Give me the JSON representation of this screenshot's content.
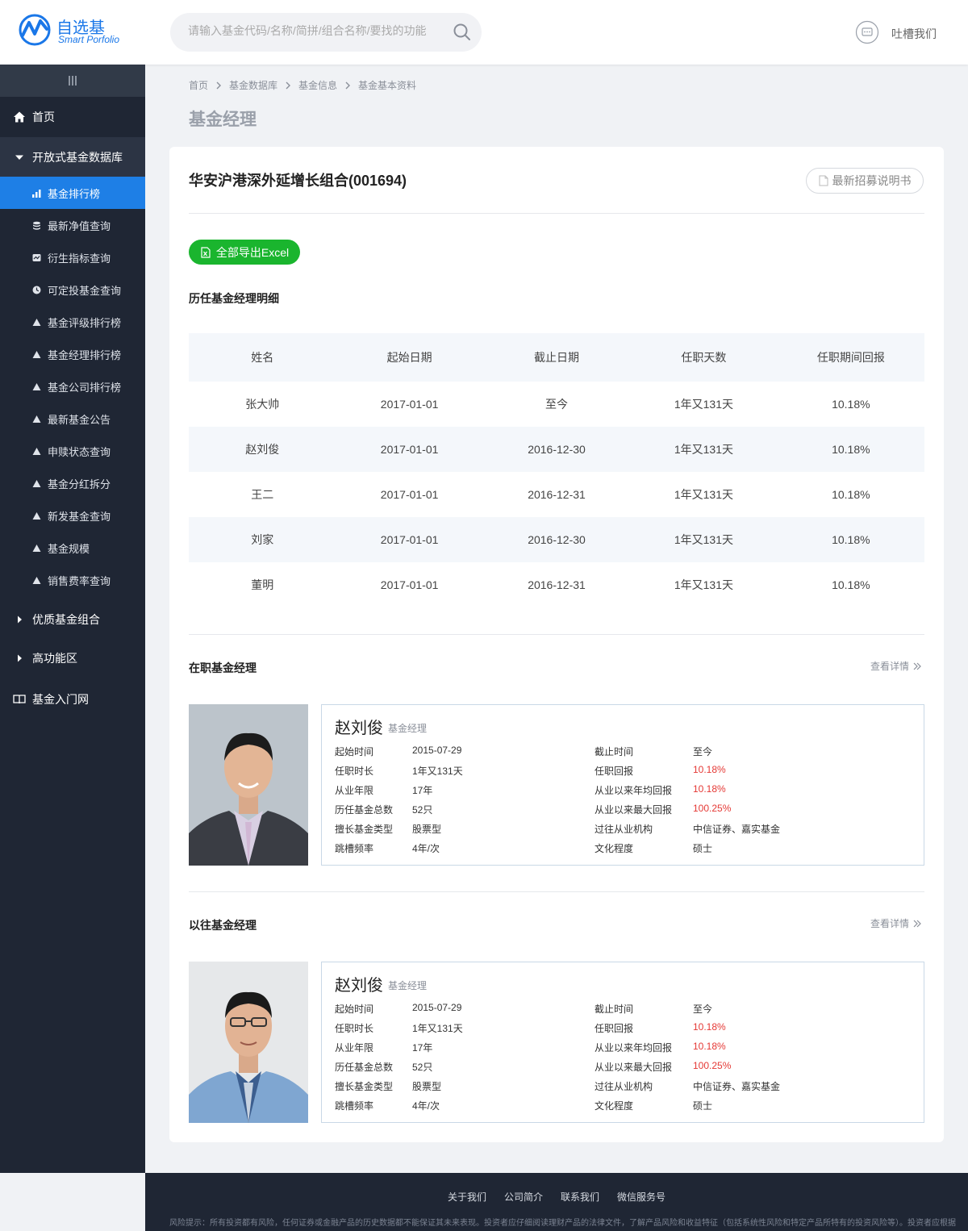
{
  "header": {
    "logo_cn": "自选基",
    "logo_en": "Smart Porfolio",
    "search_placeholder": "请输入基金代码/名称/简拼/组合名称/要找的功能",
    "feedback_label": "吐槽我们"
  },
  "sidebar": {
    "home": "首页",
    "open_fund_db": "开放式基金数据库",
    "sub_items": [
      "基金排行榜",
      "最新净值查询",
      "衍生指标查询",
      "可定投基金查询",
      "基金评级排行榜",
      "基金经理排行榜",
      "基金公司排行榜",
      "最新基金公告",
      "申赎状态查询",
      "基金分红拆分",
      "新发基金查询",
      "基金规模",
      "销售费率查询"
    ],
    "quality_portfolio": "优质基金组合",
    "advanced": "高功能区",
    "intro": "基金入门网"
  },
  "breadcrumb": [
    "首页",
    "基金数据库",
    "基金信息",
    "基金基本资料"
  ],
  "page_title": "基金经理",
  "fund": {
    "title": "华安沪港深外延增长组合(001694)",
    "prospectus_label": "最新招募说明书",
    "export_label": "全部导出Excel"
  },
  "history": {
    "title": "历任基金经理明细",
    "columns": [
      "姓名",
      "起始日期",
      "截止日期",
      "任职天数",
      "任职期间回报"
    ],
    "rows": [
      [
        "张大帅",
        "2017-01-01",
        "至今",
        "1年又131天",
        "10.18%"
      ],
      [
        "赵刘俊",
        "2017-01-01",
        "2016-12-30",
        "1年又131天",
        "10.18%"
      ],
      [
        "王二",
        "2017-01-01",
        "2016-12-31",
        "1年又131天",
        "10.18%"
      ],
      [
        "刘家",
        "2017-01-01",
        "2016-12-30",
        "1年又131天",
        "10.18%"
      ],
      [
        "董明",
        "2017-01-01",
        "2016-12-31",
        "1年又131天",
        "10.18%"
      ]
    ]
  },
  "current": {
    "title": "在职基金经理",
    "more": "查看详情",
    "manager": {
      "name": "赵刘俊",
      "role": "基金经理",
      "left": [
        [
          "起始时间",
          "2015-07-29"
        ],
        [
          "任职时长",
          "1年又131天"
        ],
        [
          "从业年限",
          "17年"
        ],
        [
          "历任基金总数",
          "52只"
        ],
        [
          "擅长基金类型",
          "股票型"
        ],
        [
          "跳槽频率",
          "4年/次"
        ]
      ],
      "right": [
        [
          "截止时间",
          "至今"
        ],
        [
          "任职回报",
          "10.18%"
        ],
        [
          "从业以来年均回报",
          "10.18%"
        ],
        [
          "从业以来最大回报",
          "100.25%"
        ],
        [
          "过往从业机构",
          "中信证券、嘉实基金"
        ],
        [
          "文化程度",
          "硕士"
        ]
      ]
    }
  },
  "past": {
    "title": "以往基金经理",
    "more": "查看详情",
    "manager": {
      "name": "赵刘俊",
      "role": "基金经理",
      "left": [
        [
          "起始时间",
          "2015-07-29"
        ],
        [
          "任职时长",
          "1年又131天"
        ],
        [
          "从业年限",
          "17年"
        ],
        [
          "历任基金总数",
          "52只"
        ],
        [
          "擅长基金类型",
          "股票型"
        ],
        [
          "跳槽频率",
          "4年/次"
        ]
      ],
      "right": [
        [
          "截止时间",
          "至今"
        ],
        [
          "任职回报",
          "10.18%"
        ],
        [
          "从业以来年均回报",
          "10.18%"
        ],
        [
          "从业以来最大回报",
          "100.25%"
        ],
        [
          "过往从业机构",
          "中信证券、嘉实基金"
        ],
        [
          "文化程度",
          "硕士"
        ]
      ]
    }
  },
  "footer": {
    "links": [
      "关于我们",
      "公司简介",
      "联系我们",
      "微信服务号"
    ],
    "risk": "风险提示：所有投资都有风险，任何证券或金融产品的历史数据都不能保证其未来表现。投资者应仔细阅读理财产品的法律文件，了解产品风险和收益特征（包括系统性风险和特定产品所特有的投资风险等）。投资者应根据"
  },
  "colors": {
    "accent": "#1e7fe6",
    "sidebar_bg": "#1f2634",
    "export_green": "#1ab52e",
    "return_red": "#e53935"
  }
}
